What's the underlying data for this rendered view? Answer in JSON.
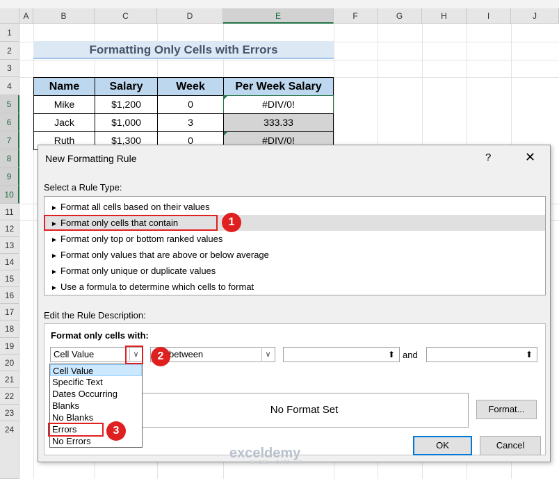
{
  "columns": [
    "A",
    "B",
    "C",
    "D",
    "E",
    "F",
    "G",
    "H",
    "I",
    "J"
  ],
  "rows": [
    "1",
    "2",
    "3",
    "4",
    "5",
    "6",
    "7",
    "8",
    "9",
    "10",
    "11",
    "12",
    "13",
    "14",
    "15",
    "16",
    "17",
    "18",
    "19",
    "20",
    "21",
    "22",
    "23",
    "24"
  ],
  "sheet_title": "Formatting Only Cells with Errors",
  "table": {
    "headers": [
      "Name",
      "Salary",
      "Week",
      "Per Week Salary"
    ],
    "rows": [
      [
        "Mike",
        "$1,200",
        "0",
        "#DIV/0!"
      ],
      [
        "Jack",
        "$1,000",
        "3",
        "333.33"
      ],
      [
        "Ruth",
        "$1,300",
        "0",
        "#DIV/0!"
      ]
    ]
  },
  "dialog": {
    "title": "New Formatting Rule",
    "help": "?",
    "close": "✕",
    "rule_type_label": "Select a Rule Type:",
    "rule_types": [
      "Format all cells based on their values",
      "Format only cells that contain",
      "Format only top or bottom ranked values",
      "Format only values that are above or below average",
      "Format only unique or duplicate values",
      "Use a formula to determine which cells to format"
    ],
    "selected_rule_index": 1,
    "edit_desc_label": "Edit the Rule Description:",
    "format_only_label": "Format only cells with:",
    "combo1_value": "Cell Value",
    "combo2_value": "between",
    "and_label": "and",
    "preview_text": "No Format Set",
    "format_button": "Format...",
    "ok_button": "OK",
    "cancel_button": "Cancel",
    "dropdown_items": [
      "Cell Value",
      "Specific Text",
      "Dates Occurring",
      "Blanks",
      "No Blanks",
      "Errors",
      "No Errors"
    ],
    "dropdown_selected": 0
  },
  "callouts": [
    "1",
    "2",
    "3"
  ],
  "watermark": "exceldemy",
  "watermark_sub": "EXCEL · DATA · BI",
  "colors": {
    "accent_red": "#e02020",
    "header_blue": "#bdd7ee",
    "title_bg": "#dde8f5",
    "excel_green": "#217346"
  }
}
